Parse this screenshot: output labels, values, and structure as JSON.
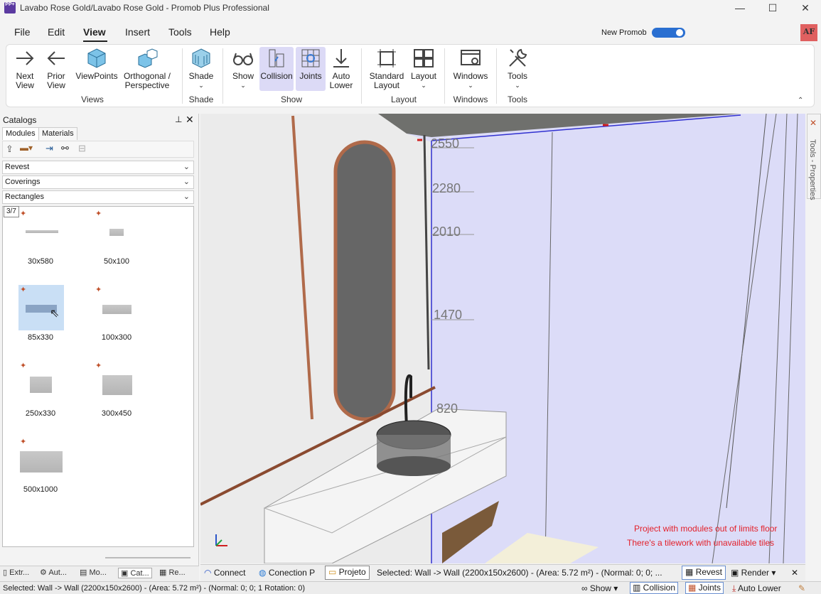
{
  "window": {
    "title": "Lavabo Rose Gold/Lavabo Rose Gold - Promob Plus Professional",
    "app_icon": "PP+",
    "minimize": "—",
    "maximize": "☐",
    "close": "✕"
  },
  "menu": [
    "File",
    "Edit",
    "View",
    "Insert",
    "Tools",
    "Help"
  ],
  "header": {
    "new_promob_label": "New Promob",
    "new_promob_on": true,
    "avatar": "AF"
  },
  "ribbon": {
    "buttons": {
      "next_view": "Next View",
      "prior_view": "Prior View",
      "viewpoints": "ViewPoints",
      "ortho": "Orthogonal / Perspective",
      "shade": "Shade",
      "show": "Show",
      "collision": "Collision",
      "joints": "Joints",
      "auto_lower": "Auto Lower",
      "standard_layout": "Standard Layout",
      "layout": "Layout",
      "windows": "Windows",
      "tools": "Tools"
    },
    "groups": {
      "views": "Views",
      "shade": "Shade",
      "show": "Show",
      "layout": "Layout",
      "windows": "Windows",
      "tools": "Tools"
    },
    "collapse": "⌃"
  },
  "catalog": {
    "title": "Catalogs",
    "pin": "📌",
    "close": "✕",
    "tabs": [
      "Modules",
      "Materials"
    ],
    "dropdowns": [
      "Revest",
      "Coverings",
      "Rectangles"
    ],
    "page": "3/7",
    "items": [
      {
        "label": "30x580",
        "selected": false
      },
      {
        "label": "50x100",
        "selected": false
      },
      {
        "label": "85x330",
        "selected": true
      },
      {
        "label": "100x300",
        "selected": false
      },
      {
        "label": "250x330",
        "selected": false
      },
      {
        "label": "300x450",
        "selected": false
      },
      {
        "label": "500x1000",
        "selected": false
      }
    ],
    "bottom_tabs": [
      "Extr...",
      "Aut...",
      "Mo...",
      "Cat...",
      "Re..."
    ]
  },
  "viewport": {
    "dims": [
      "2550",
      "2280",
      "2010",
      "1470",
      "820"
    ],
    "warnings": [
      "Project with modules out of limits floor",
      "There's a tilework with unavailable tiles"
    ]
  },
  "vp_status": {
    "connect": "Connect",
    "conection": "Conection P",
    "projeto": "Projeto",
    "selected": "Selected: Wall -> Wall (2200x150x2600) - (Area: 5.72 m²) - (Normal: 0; 0; ...",
    "revest": "Revest",
    "render": "Render",
    "close": "✕"
  },
  "right_strip": "Tools - Properties",
  "status": {
    "text": "Selected: Wall -> Wall (2200x150x2600) - (Area: 5.72 m²) - (Normal: 0; 0; 1 Rotation: 0)",
    "show": "Show",
    "collision": "Collision",
    "joints": "Joints",
    "auto_lower": "Auto Lower"
  }
}
